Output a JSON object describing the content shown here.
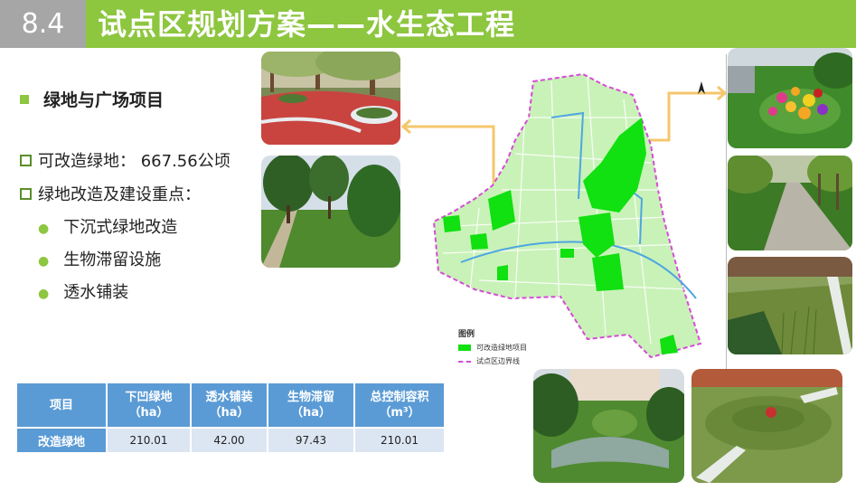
{
  "header": {
    "section_number": "8.4",
    "title": "试点区规划方案——水生态工程"
  },
  "section": {
    "heading": "绿地与广场项目",
    "item1": "可改造绿地： 667.56公顷",
    "item2": "绿地改造及建设重点：",
    "sub_items": [
      "下沉式绿地改造",
      "生物滞留设施",
      "透水铺装"
    ]
  },
  "legend": {
    "title": "图例",
    "items": [
      {
        "label": "可改造绿地项目",
        "color": "#11e011"
      },
      {
        "label": "试点区边界线",
        "color": "#d64bd6"
      }
    ]
  },
  "table": {
    "headers": [
      "项目",
      "下凹绿地\n（ha）",
      "透水铺装\n（ha）",
      "生物滞留\n（ha）",
      "总控制容积\n（m³）"
    ],
    "row": [
      "改造绿地",
      "210.01",
      "42.00",
      "97.43",
      "210.01"
    ]
  },
  "colors": {
    "accent_green": "#8dc63f",
    "header_grey": "#a6a6a6",
    "table_blue": "#5b9bd5",
    "table_light": "#dce6f2",
    "arrow": "#f5c76b"
  }
}
